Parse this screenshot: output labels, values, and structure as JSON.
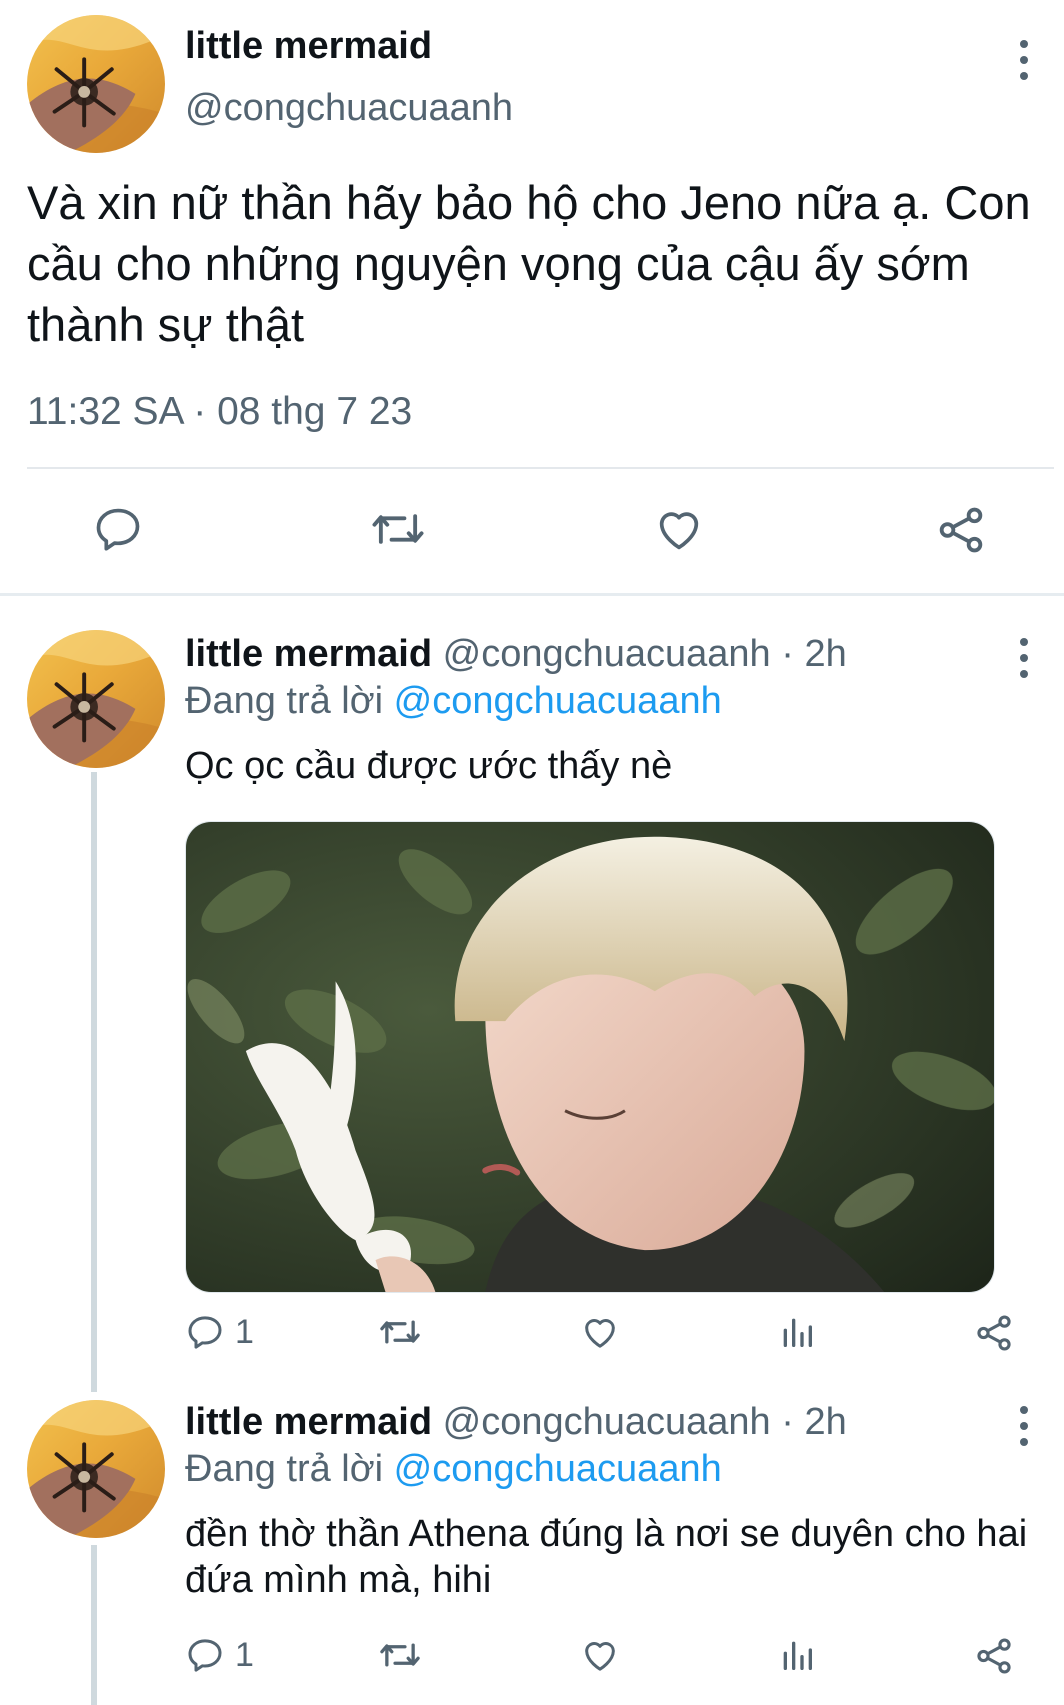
{
  "main_tweet": {
    "display_name": "little mermaid",
    "handle": "@congchuacuaanh",
    "text": "Và xin nữ thần hãy bảo hộ cho Jeno nữa ạ. Con cầu cho những nguyện vọng của cậu ấy sớm thành sự thật",
    "timestamp": "11:32 SA · 08 thg 7 23",
    "actions": [
      "reply-icon",
      "retweet-icon",
      "like-icon",
      "share-icon"
    ]
  },
  "replies": [
    {
      "display_name": "little mermaid",
      "meta": "@congchuacuaanh · 2h",
      "replying_prefix": "Đang trả lời ",
      "replying_to": "@congchuacuaanh",
      "text": "Ọc ọc cầu được ước thấy nè",
      "has_media": true,
      "reply_count": "1"
    },
    {
      "display_name": "little mermaid",
      "meta": "@congchuacuaanh · 2h",
      "replying_prefix": "Đang trả lời ",
      "replying_to": "@congchuacuaanh",
      "text": "đền thờ thần Athena đúng là nơi se duyên cho hai đứa mình mà, hihi",
      "has_media": false,
      "reply_count": "1"
    }
  ],
  "colors": {
    "text_primary": "#0f1419",
    "text_secondary": "#536471",
    "link": "#1d9bf0",
    "divider": "#e6ecf0",
    "thread_line": "#cfd9de"
  }
}
